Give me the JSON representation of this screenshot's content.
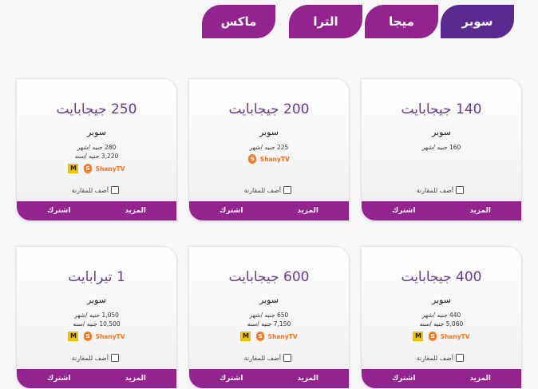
{
  "tabs": [
    {
      "label": "سوبر",
      "active": true
    },
    {
      "label": "ميجا",
      "active": false
    },
    {
      "label": "الترا",
      "active": false
    },
    {
      "label": "ماكس",
      "active": false
    }
  ],
  "common": {
    "compare_label": "أضف للمقارنة",
    "subscribe_label": "اشترك",
    "more_label": "المزيد",
    "streaming_brand": "ЅhanyTV",
    "badge_m": "M",
    "badge_s": "S"
  },
  "cards": [
    {
      "title": "140 جيجابايت",
      "plan": "سوبر",
      "price_month": "160 جنيه /شهر",
      "price_year": ""
    },
    {
      "title": "200 جيجابايت",
      "plan": "سوبر",
      "price_month": "225 جنيه /شهر",
      "price_year": ""
    },
    {
      "title": "250 جيجابايت",
      "plan": "سوبر",
      "price_month": "280 جنيه /شهر",
      "price_year": "3,220 جنيه /سنه"
    },
    {
      "title": "400 جيجابايت",
      "plan": "سوبر",
      "price_month": "440 جنيه /شهر",
      "price_year": "5,060 جنيه /سنه"
    },
    {
      "title": "600 جيجابايت",
      "plan": "سوبر",
      "price_month": "650 جنيه /شهر",
      "price_year": "7,150 جنيه /سنه"
    },
    {
      "title": "1 تيرابايت",
      "plan": "سوبر",
      "price_month": "1,050 جنيه /شهر",
      "price_year": "10,500 جنيه /سنه"
    }
  ],
  "colors": {
    "tab_active": "#5a2a91",
    "tab": "#93248f",
    "bar": "#93248f"
  }
}
